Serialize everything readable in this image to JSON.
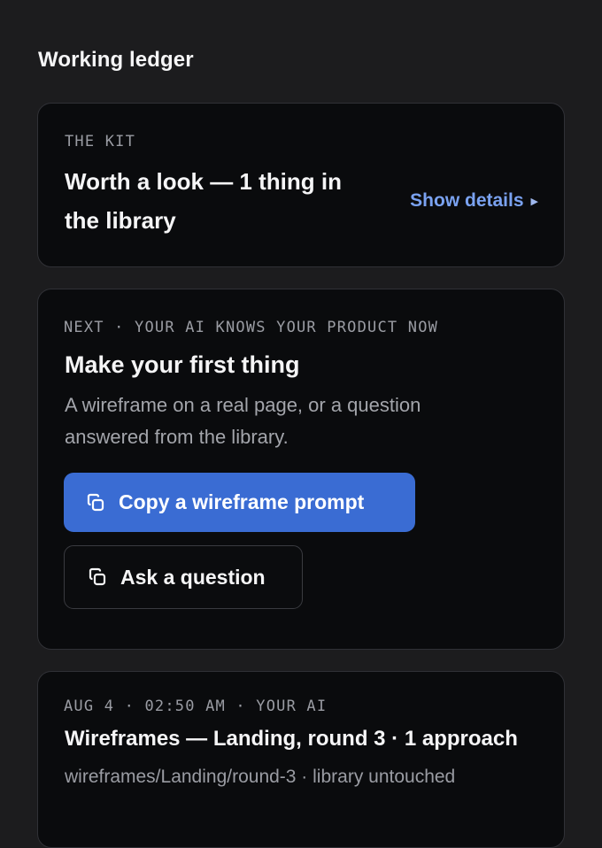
{
  "panel": {
    "title": "Working ledger"
  },
  "kit_card": {
    "kicker": "THE KIT",
    "headline": "Worth a look — 1 thing in the library",
    "show_details_label": "Show details"
  },
  "next_card": {
    "kicker": "NEXT · YOUR AI KNOWS YOUR PRODUCT NOW",
    "title": "Make your first thing",
    "description": "A wireframe on a real page, or a question answered from the library.",
    "primary_button_label": "Copy a wireframe prompt",
    "secondary_button_label": "Ask a question"
  },
  "activity_card": {
    "kicker": "AUG 4 · 02:50 AM · YOUR AI",
    "title": "Wireframes — Landing, round 3 · 1 approach",
    "meta": "wireframes/Landing/round-3 · library untouched"
  },
  "colors": {
    "background": "#1c1c1e",
    "card": "#0a0b0d",
    "accent": "#3a6cd3",
    "link": "#7aa2f0"
  },
  "icons": {
    "show_details": "caret-right-icon",
    "primary_button": "copy-icon",
    "secondary_button": "copy-icon"
  }
}
